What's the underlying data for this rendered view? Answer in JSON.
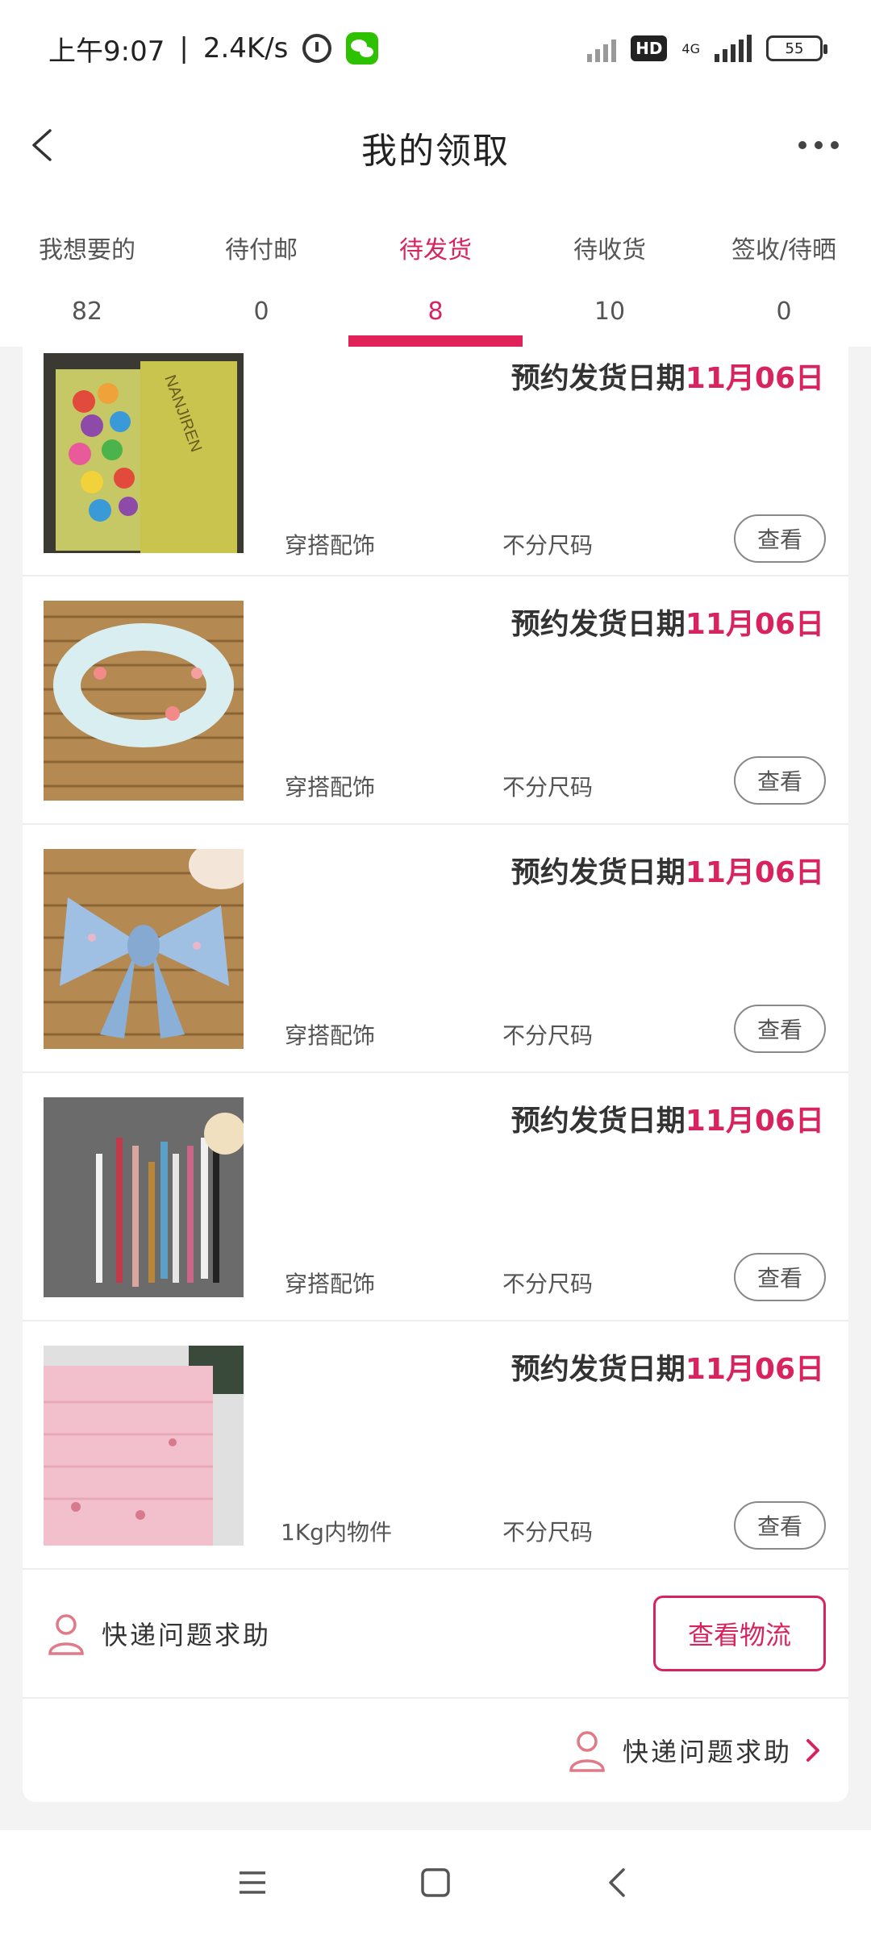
{
  "status_bar": {
    "time": "上午9:07",
    "speed": "2.4K/s",
    "network": "4G",
    "hd": "HD",
    "battery": "55"
  },
  "header": {
    "title": "我的领取"
  },
  "tabs": [
    {
      "label": "我想要的",
      "count": "82"
    },
    {
      "label": "待付邮",
      "count": "0"
    },
    {
      "label": "待发货",
      "count": "8"
    },
    {
      "label": "待收货",
      "count": "10"
    },
    {
      "label": "签收/待晒",
      "count": "0"
    }
  ],
  "items": [
    {
      "date_prefix": "预约发货日期",
      "date_value": "11月06日",
      "category": "穿搭配饰",
      "size": "不分尺码",
      "button": "查看"
    },
    {
      "date_prefix": "预约发货日期",
      "date_value": "11月06日",
      "category": "穿搭配饰",
      "size": "不分尺码",
      "button": "查看"
    },
    {
      "date_prefix": "预约发货日期",
      "date_value": "11月06日",
      "category": "穿搭配饰",
      "size": "不分尺码",
      "button": "查看"
    },
    {
      "date_prefix": "预约发货日期",
      "date_value": "11月06日",
      "category": "穿搭配饰",
      "size": "不分尺码",
      "button": "查看"
    },
    {
      "date_prefix": "预约发货日期",
      "date_value": "11月06日",
      "category": "1Kg内物件",
      "size": "不分尺码",
      "button": "查看"
    }
  ],
  "thumb_text": {
    "bag_brand": "NANJIREN"
  },
  "help": {
    "label": "快递问题求助",
    "logistics_button": "查看物流",
    "footer_label": "快递问题求助"
  },
  "colors": {
    "accent": "#d8245e",
    "tab_indicator": "#e0215a"
  }
}
